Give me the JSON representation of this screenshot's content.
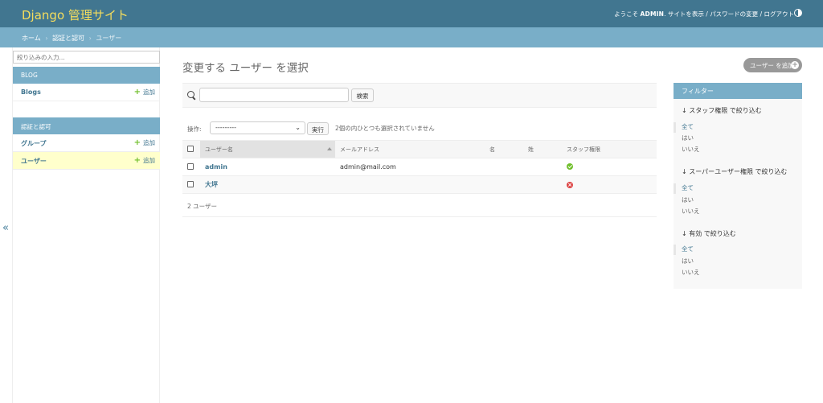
{
  "header": {
    "branding": "Django 管理サイト",
    "welcome": "ようこそ",
    "username": "ADMIN",
    "view_site": "サイトを表示",
    "change_password": "パスワードの変更",
    "logout": "ログアウト",
    "sep": "/"
  },
  "breadcrumbs": {
    "home": "ホーム",
    "app": "認証と認可",
    "current": "ユーザー",
    "sep": "›"
  },
  "sidebar": {
    "filter_placeholder": "絞り込みの入力...",
    "apps": [
      {
        "caption": "BLOG",
        "models": [
          {
            "name": "Blogs",
            "add": "追加"
          }
        ]
      },
      {
        "caption": "認証と認可",
        "models": [
          {
            "name": "グループ",
            "add": "追加"
          },
          {
            "name": "ユーザー",
            "add": "追加"
          }
        ]
      }
    ],
    "toggle": "«"
  },
  "content": {
    "title": "変更する ユーザー を選択",
    "add_button": "ユーザー を追加",
    "search_button": "検索",
    "actions_label": "操作:",
    "action_selected": "---------",
    "run_button": "実行",
    "selection_counter": "2個の内ひとつも選択されていません",
    "columns": [
      "ユーザー名",
      "メールアドレス",
      "名",
      "姓",
      "スタッフ権限"
    ],
    "rows": [
      {
        "username": "admin",
        "email": "admin@mail.com",
        "first_name": "",
        "last_name": "",
        "is_staff": true
      },
      {
        "username": "大坪",
        "email": "",
        "first_name": "",
        "last_name": "",
        "is_staff": false
      }
    ],
    "paginator": "2 ユーザー"
  },
  "filter": {
    "title": "フィルター",
    "groups": [
      {
        "heading": "↓ スタッフ権限 で絞り込む",
        "choices": [
          "全て",
          "はい",
          "いいえ"
        ]
      },
      {
        "heading": "↓ スーパーユーザー権限 で絞り込む",
        "choices": [
          "全て",
          "はい",
          "いいえ"
        ]
      },
      {
        "heading": "↓ 有効 で絞り込む",
        "choices": [
          "全て",
          "はい",
          "いいえ"
        ]
      }
    ]
  },
  "colors": {
    "header": "#417690",
    "branding": "#f5dd5d",
    "breadcrumbs": "#79aec8",
    "selected_row": "#ffffcc",
    "yes": "#70bf2b",
    "no": "#dd4646"
  }
}
